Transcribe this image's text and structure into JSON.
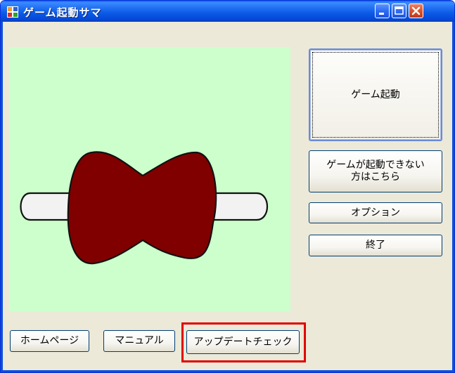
{
  "window": {
    "title": "ゲーム起動サマ"
  },
  "buttons": {
    "launch": "ゲーム起動",
    "help": "ゲームが起動できない\n方はこちら",
    "options": "オプション",
    "exit": "終了",
    "homepage": "ホームページ",
    "manual": "マニュアル",
    "update": "アップデートチェック"
  },
  "icons": {
    "app": "app-icon",
    "minimize": "minimize-icon",
    "maximize": "maximize-icon",
    "close": "close-icon",
    "bone": "bone-icon"
  },
  "colors": {
    "canvas_bg": "#ccffcc",
    "bone_body": "#800000",
    "highlight": "#e00000"
  }
}
